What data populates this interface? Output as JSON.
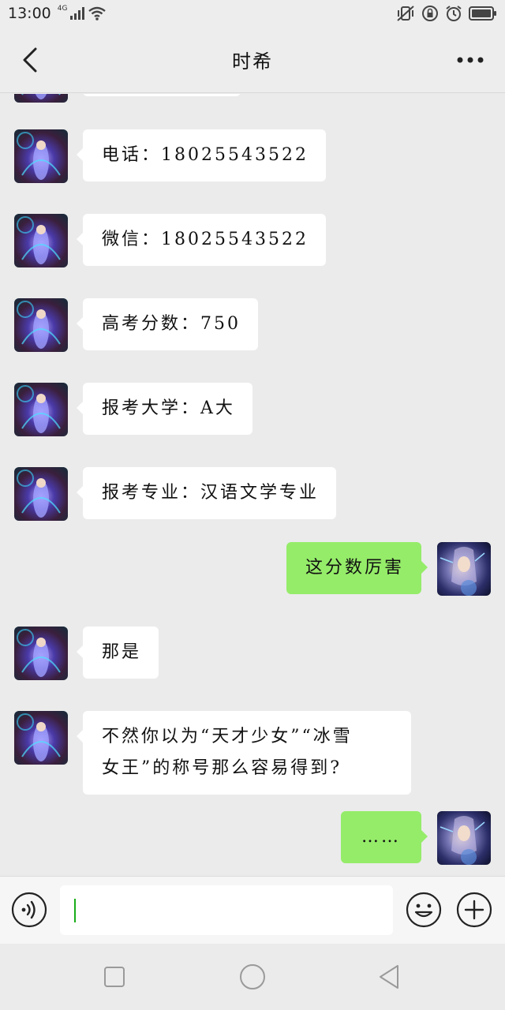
{
  "status_bar": {
    "time": "13:00",
    "network": "4G"
  },
  "header": {
    "title": "时希",
    "back_icon": "back-chevron-icon",
    "more_icon": "more-dots-icon"
  },
  "colors": {
    "sent_bubble": "#95ec69",
    "received_bubble": "#ffffff",
    "chat_bg": "#ebebeb"
  },
  "messages": [
    {
      "side": "left",
      "text": ""
    },
    {
      "side": "left",
      "text": "电话：18025543522"
    },
    {
      "side": "left",
      "text": "微信：18025543522"
    },
    {
      "side": "left",
      "text": "高考分数：750"
    },
    {
      "side": "left",
      "text": "报考大学：A大"
    },
    {
      "side": "left",
      "text": "报考专业：汉语文学专业"
    },
    {
      "side": "right",
      "text": "这分数厉害"
    },
    {
      "side": "left",
      "text": "那是"
    },
    {
      "side": "left",
      "text": "不然你以为“天才少女”“冰雪\n女王”的称号那么容易得到?"
    },
    {
      "side": "right",
      "text": "……"
    }
  ],
  "input": {
    "value": "",
    "placeholder": ""
  }
}
